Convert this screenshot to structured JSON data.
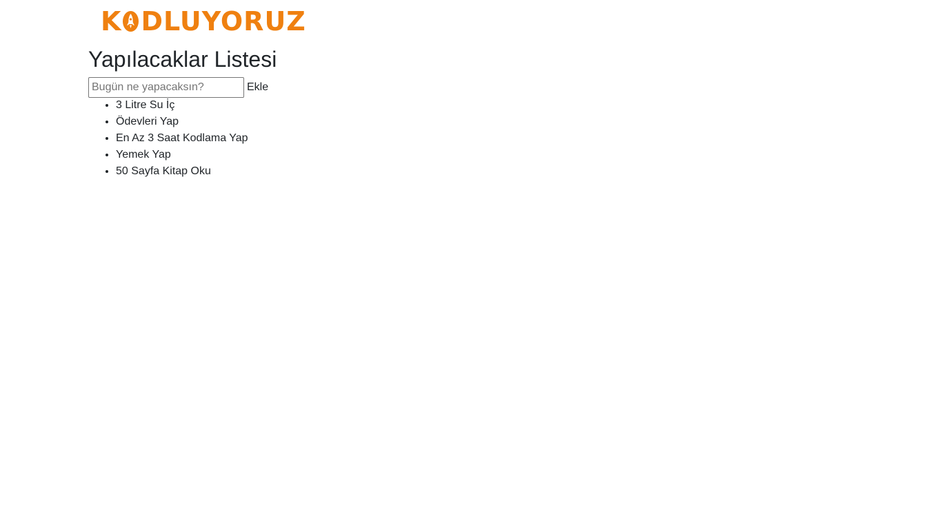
{
  "logo": {
    "letter_k": "K",
    "rest": "DLUYORUZ",
    "color": "#ef8010"
  },
  "title": "Yapılacaklar Listesi",
  "input": {
    "placeholder": "Bugün ne yapacaksın?",
    "value": ""
  },
  "add_button_label": "Ekle",
  "tasks": [
    "3 Litre Su İç",
    "Ödevleri Yap",
    "En Az 3 Saat Kodlama Yap",
    "Yemek Yap",
    "50 Sayfa Kitap Oku"
  ]
}
